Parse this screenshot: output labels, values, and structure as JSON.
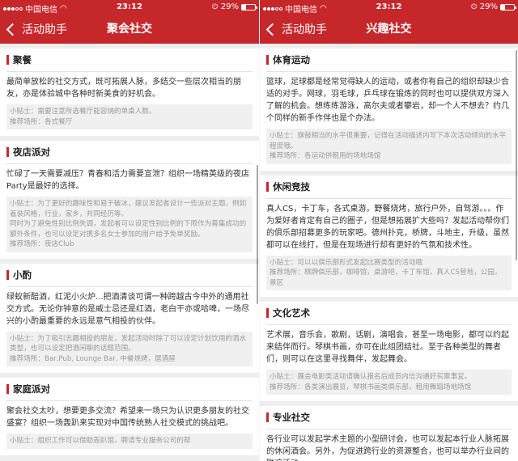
{
  "status": {
    "carrier": "中国电信",
    "time": "23:12",
    "battery_pct": "29%",
    "battery_level": 0.29
  },
  "left": {
    "nav": {
      "back_label": "活动助手",
      "title": "聚会社交"
    },
    "cards": [
      {
        "title": "聚餐",
        "desc": "最简单放松的社交方式，既可拓展人脉，多结交一些层次相当的朋友，亦是体验城中各种时新美食的好机会。",
        "tips": [
          "小贴士：需要注意所选餐厅能容纳的单桌人数。",
          "推荐场所：各式餐厅"
        ]
      },
      {
        "title": "夜店派对",
        "desc": "忙碌了一天需要减压？青春和活力需要宣泄？组织一场精英级的夜店Party是最好的选择。",
        "tips": [
          "小贴士：为了更好的趣味性和易于破冰，建议发起者设计一些派对主题，例如着装风格，行业，家乡，共同经历等。",
          "同时为了避免性别比例失调，发起者可以设定性别比例的下限作为募集成功的额外条件，也可以设定对携多名女士参加的用户给予免单奖励。",
          "推荐场所：夜店Club"
        ]
      },
      {
        "title": "小酌",
        "desc": "绿蚁新醅酒，红泥小火炉...把酒清谈可谓一种跨越古今中外的通用社交方式。无论你钟意的是威士忌还是红酒，老白干亦或哈啤，一场尽兴的小酌最重要的永远是意气相投的伙伴。",
        "tips": [
          "小贴士：为了吸引志趣相投的朋友，发起活动时除了可以设定计划饮用的酒水类型，也可以设定把酒闲聊的话题范围。",
          "推荐场所：Bar,Pub, Lounge Bar, 中餐烧烤，居酒屋"
        ]
      },
      {
        "title": "家庭派对",
        "desc": "聚会社交太吵，想要更多交流？希望来一场只为认识更多朋友的社交盛宴？组织一场轰趴来实现对中国传统熟人社交模式的挑战吧。",
        "tips": [
          "小贴士：组织工作可以借助轰趴馆，聘请专业服务公司的帮"
        ]
      }
    ]
  },
  "right": {
    "nav": {
      "back_label": "活动助手",
      "title": "兴趣社交"
    },
    "cards": [
      {
        "title": "体育运动",
        "desc": "篮球，足球都是经常觉得缺人的运动，或者你有自己的组织却缺少合适的对手。网球，羽毛球，乒乓球在锻炼的同时也可以提供双方深入了解的机会。想练练游泳，高尔夫或者攀岩，却一个人不想去？约几个同样的新手作伴也是个办法。",
        "tips": [
          "小贴士：旗鼓相当的水平很重要，记得在活动描述内写下本次活动倾向的水平程度哦。",
          "推荐场所：各运动供租用的场地场馆"
        ]
      },
      {
        "title": "休闲竞技",
        "desc": "真人CS，卡丁车，各式桌游，野餐烧烤，旅行户外，自驾游。。。作为爱好者肯定有自己的圈子，但是想拓展扩大些吗？发起活动帮你们的俱乐部招募更多的玩家吧。德州扑克，桥牌，斗地主，升级，虽然都可以在线打，但是在现场进行却有更好的气氛和技术性。",
        "tips": [
          "小贴士：可以以俱乐部形式发起比赛类型的活动哦",
          "推荐场所：棋牌俱乐部，咖啡馆，桌游吧，卡丁车馆，真人CS营地，公园，景区"
        ]
      },
      {
        "title": "文化艺术",
        "desc": "艺术展，音乐会，歌剧，话剧，演唱会，甚至一场电影，都可以约起来结伴而行。琴棋书画，亦可在此组团结社。至于各种类型的舞者们，则可以在这里寻找舞伴，发起舞会。",
        "tips": [
          "小贴士：展会电影类活动请确认报名后成员内信沟通好买票事宜。",
          "推荐场所：各类演出展览，琴棋书画类俱乐部，租用舞蹈场地场馆"
        ]
      },
      {
        "title": "专业社交",
        "desc": "各行业可以发起学术主题的小型研讨会，也可以发起本行业人脉拓展的休闲酒会。另外，为促进跨行业的资源整合，也可以举办行业间的联谊活动。",
        "tips": []
      }
    ]
  }
}
